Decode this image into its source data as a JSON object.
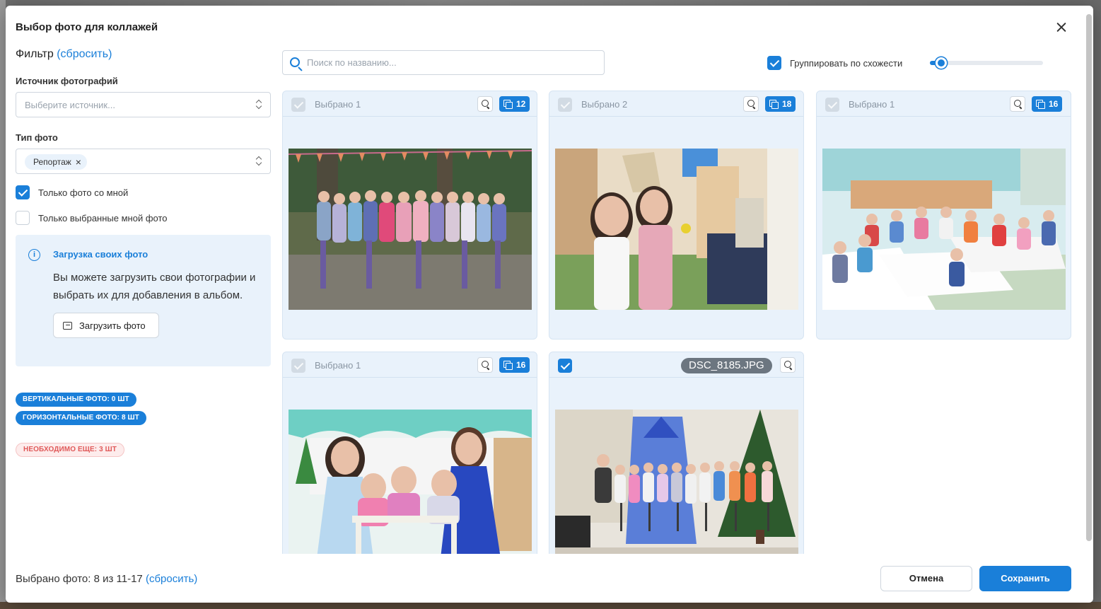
{
  "modal": {
    "title": "Выбор фото для коллажей"
  },
  "filter": {
    "heading": "Фильтр",
    "reset_label": "(сбросить)",
    "source_label": "Источник фотографий",
    "source_placeholder": "Выберите источник...",
    "type_label": "Тип фото",
    "type_chip": "Репортаж",
    "type_chip_remove": "×",
    "only_with_me": {
      "label": "Только фото со мной",
      "checked": true
    },
    "only_selected_by_me": {
      "label": "Только выбранные мной фото",
      "checked": false
    }
  },
  "upload": {
    "info_icon": "i",
    "title": "Загрузка своих фото",
    "text": "Вы можете загрузить свои фотографии и выбрать их для добавления в альбом.",
    "button_label": "Загрузить фото"
  },
  "stats": {
    "vertical": "ВЕРТИКАЛЬНЫЕ ФОТО: 0 ШТ",
    "horizontal": "ГОРИЗОНТАЛЬНЫЕ ФОТО: 8 ШТ",
    "needed": "НЕОБХОДИМО ЕЩЕ: 3 ШТ"
  },
  "search": {
    "placeholder": "Поиск по названию..."
  },
  "group": {
    "label": "Группировать по схожести",
    "checked": true,
    "similarity_level": 0.1
  },
  "cards": [
    {
      "selected_label": "Выбрано 1",
      "count": "12",
      "zoom_icon": "zoom-in-icon"
    },
    {
      "selected_label": "Выбрано 2",
      "count": "18",
      "zoom_icon": "zoom-in-icon"
    },
    {
      "selected_label": "Выбрано 1",
      "count": "16",
      "zoom_icon": "zoom-in-icon"
    },
    {
      "selected_label": "Выбрано 1",
      "count": "16",
      "zoom_icon": "zoom-in-icon"
    },
    {
      "filename": "DSC_8185.JPG",
      "checked": true,
      "zoom_icon": "zoom-in-icon"
    }
  ],
  "footer": {
    "selected_text": "Выбрано фото: 8 из 11-17",
    "reset_label": "(сбросить)",
    "cancel_label": "Отмена",
    "save_label": "Сохранить"
  },
  "colors": {
    "accent": "#1a7fd9",
    "card_bg": "#e9f2fb",
    "warn": "#e05a5a"
  }
}
